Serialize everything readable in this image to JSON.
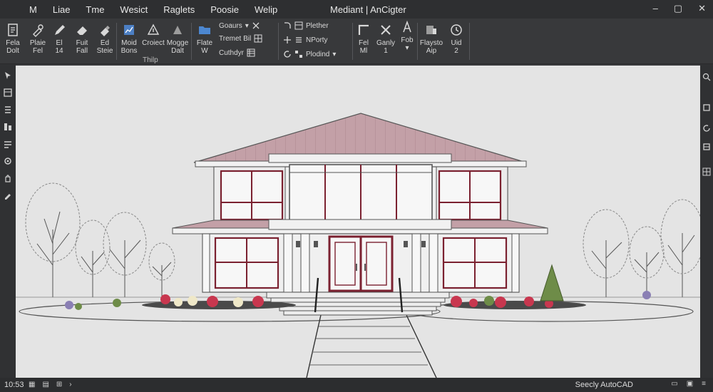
{
  "titlebar": {
    "menu": [
      "M",
      "Liae",
      "Tme",
      "Wesict",
      "Raglets",
      "Poosie",
      "Welip"
    ],
    "title": "Mediant | AnCigter",
    "controls": [
      "–",
      "▢",
      "✕"
    ]
  },
  "ribbon": {
    "tools_a": [
      {
        "label1": "Fela",
        "label2": "Dolt"
      },
      {
        "label1": "Plaie",
        "label2": "Fel"
      },
      {
        "label1": "El",
        "label2": "14"
      },
      {
        "label1": "Fuit",
        "label2": "Fall"
      },
      {
        "label1": "Ed",
        "label2": "Steie"
      },
      {
        "label1": "Moid",
        "label2": "Bons"
      },
      {
        "label1": "Croiect",
        "label2": ""
      },
      {
        "label1": "Mogge",
        "label2": "Dalt"
      }
    ],
    "group_label_a": "Thilp",
    "tools_b": [
      {
        "label1": "Flate",
        "label2": "W"
      }
    ],
    "rows_b": [
      "Goaurs",
      "Tremet Bil",
      "Cuthdyr"
    ],
    "rows_c": [
      "Plether",
      "NPorty",
      "Plodind"
    ],
    "tools_d": [
      {
        "label1": "Fel",
        "label2": "Ml"
      },
      {
        "label1": "Ganly",
        "label2": "1"
      },
      {
        "label1": "Fob",
        "label2": ""
      },
      {
        "label1": "Flaysto",
        "label2": "Aip"
      },
      {
        "label1": "Uid",
        "label2": "2"
      }
    ]
  },
  "status": {
    "time": "10:53",
    "app": "Seecly AutoCAD"
  },
  "colors": {
    "roof": "#c09aa1",
    "window_frame": "#7b2130",
    "door": "#7b2130",
    "flower_red": "#c8374f",
    "flower_white": "#efe8c8",
    "shrub": "#6e8c48",
    "canvas_bg": "#e4e4e4"
  },
  "icons": {
    "left_bar": [
      "select-icon",
      "layers-icon",
      "properties-icon",
      "blocks-icon",
      "palette-icon",
      "settings-icon",
      "hand-icon",
      "pen-icon"
    ],
    "right_bar": [
      "zoom-icon",
      "pan-icon",
      "orbit-icon",
      "view-icon",
      "grid-icon"
    ]
  }
}
